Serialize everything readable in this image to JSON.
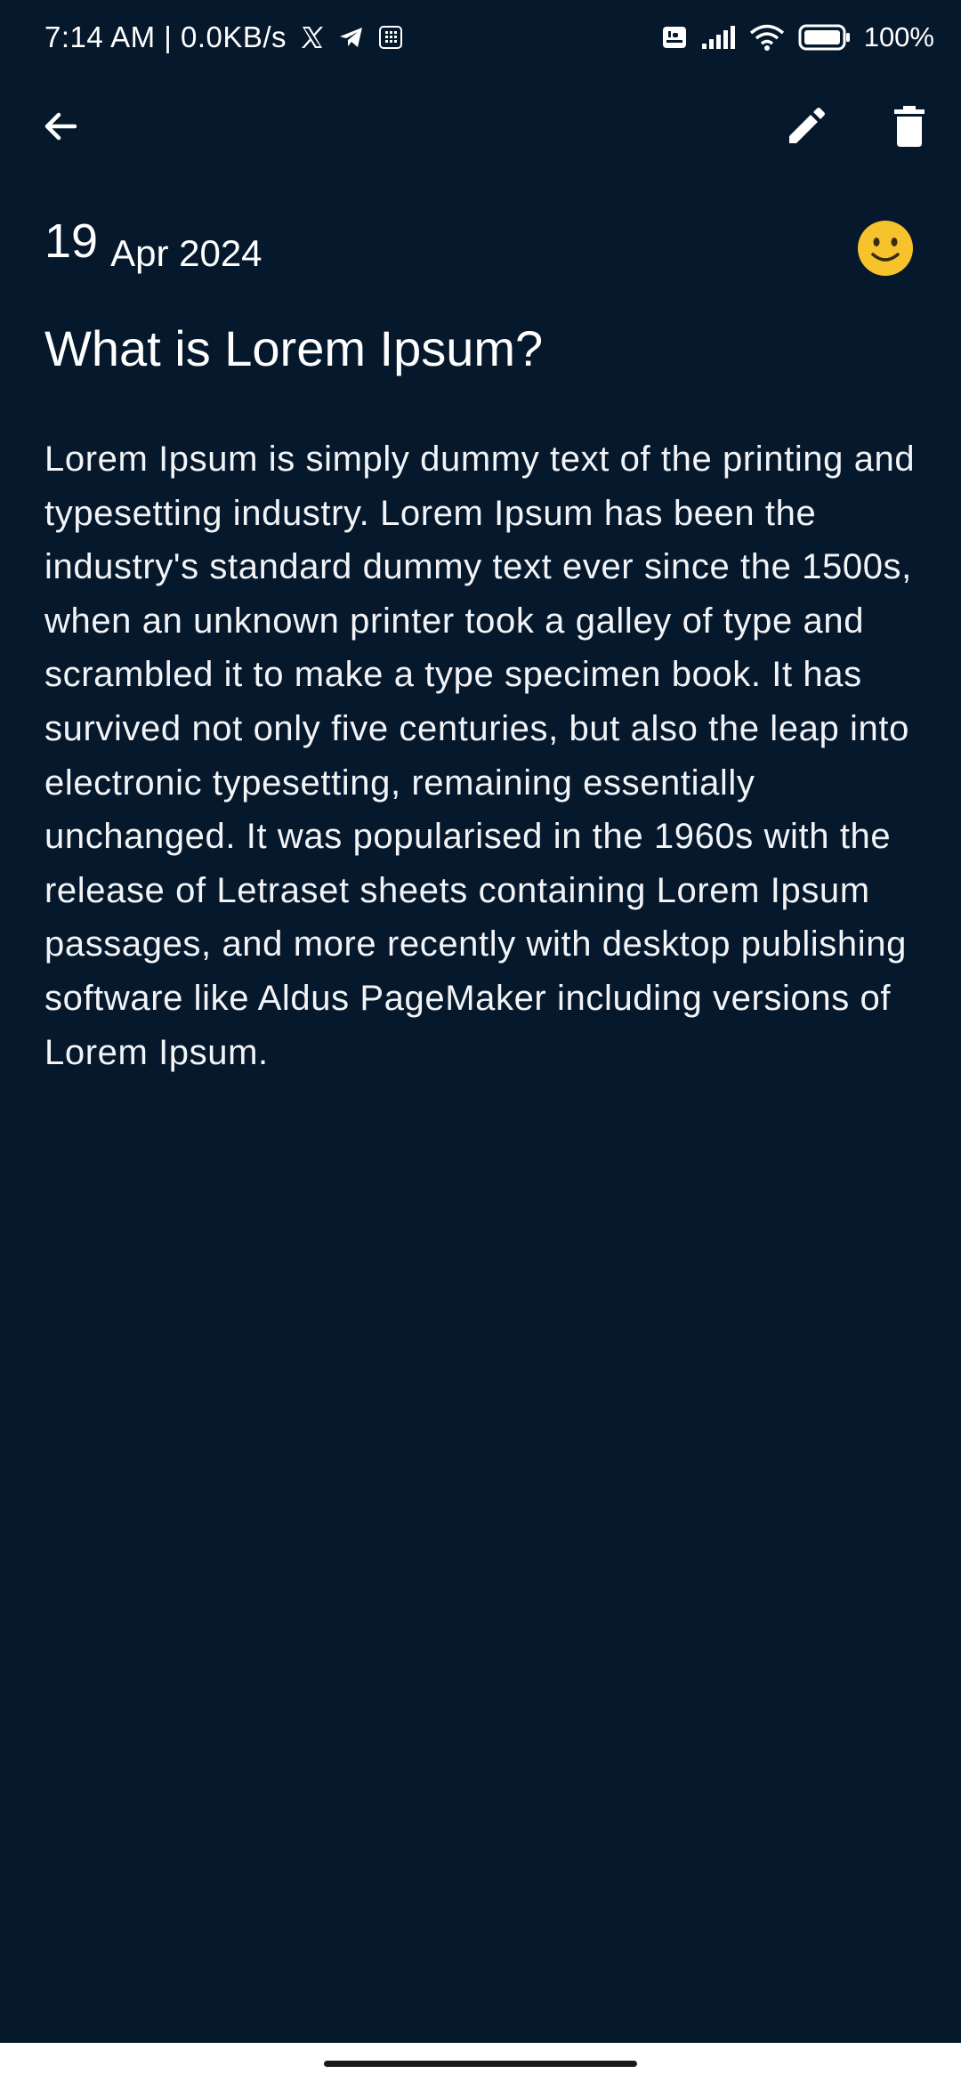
{
  "status_bar": {
    "time_and_speed": "7:14 AM | 0.0KB/s",
    "battery_percent": "100%"
  },
  "app_bar": {
    "back_icon": "arrow-left-icon",
    "edit_icon": "pencil-icon",
    "delete_icon": "trash-icon"
  },
  "note": {
    "date_day": "19",
    "date_month_year": "Apr 2024",
    "mood": "slightly-smiling-face",
    "title": "What is Lorem Ipsum?",
    "body": "Lorem Ipsum is simply dummy text of the printing and typesetting industry. Lorem Ipsum has been the industry's standard dummy text ever since the 1500s, when an unknown printer took a galley of type and scrambled it to make a type specimen book. It has survived not only five centuries, but also the leap into electronic typesetting, remaining essentially unchanged. It was popularised in the 1960s with the release of Letraset sheets containing Lorem Ipsum passages, and more recently with desktop publishing software like Aldus PageMaker including versions of Lorem Ipsum."
  },
  "colors": {
    "background": "#06182b",
    "text": "#ffffff",
    "mood_face": "#f6c32c"
  }
}
